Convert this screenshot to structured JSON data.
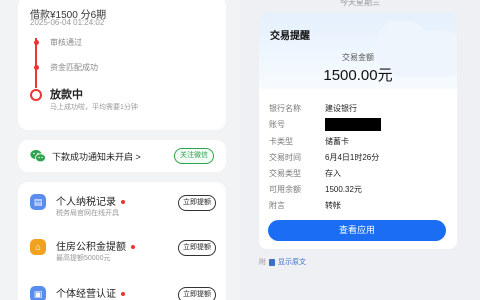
{
  "loan": {
    "header": "借款¥1500  分6期",
    "date": "2025-06-04 01:24:02",
    "steps": [
      "审核通过",
      "资金匹配成功"
    ],
    "active_step": "放款中",
    "active_sub": "马上成功啦，平均需要1分钟"
  },
  "notify": {
    "text": "下款成功通知未开启 >",
    "follow_label": "关注微信"
  },
  "services": [
    {
      "title": "个人纳税记录",
      "sub": "税务局官网在线开具",
      "button": "立即提额",
      "icon": "tax-record-icon",
      "color": "#5b8def"
    },
    {
      "title": "住房公积金提额",
      "sub": "最高提额50000元",
      "button": "立即提额",
      "icon": "house-fund-icon",
      "color": "#f0a21f"
    },
    {
      "title": "个体经营认证",
      "sub": "",
      "button": "立即提额",
      "icon": "business-cert-icon",
      "color": "#5b8def"
    }
  ],
  "right": {
    "date_header": "今天星期三",
    "message": {
      "title": "交易提醒",
      "amount_label": "交易金额",
      "amount": "1500.00元",
      "rows": [
        {
          "k": "银行名称",
          "v": "建设银行"
        },
        {
          "k": "账号",
          "v": ""
        },
        {
          "k": "卡类型",
          "v": "储蓄卡"
        },
        {
          "k": "交易时间",
          "v": "6月4日1时26分"
        },
        {
          "k": "交易类型",
          "v": "存入"
        },
        {
          "k": "可用余额",
          "v": "1500.32元"
        },
        {
          "k": "附言",
          "v": "转帐"
        }
      ],
      "button": "查看应用"
    },
    "footer_prefix": "附",
    "footer_link": "显示原文"
  },
  "colors": {
    "accent_red": "#e33333",
    "wechat_green": "#2ea44f",
    "primary_blue": "#1b6ef3"
  }
}
